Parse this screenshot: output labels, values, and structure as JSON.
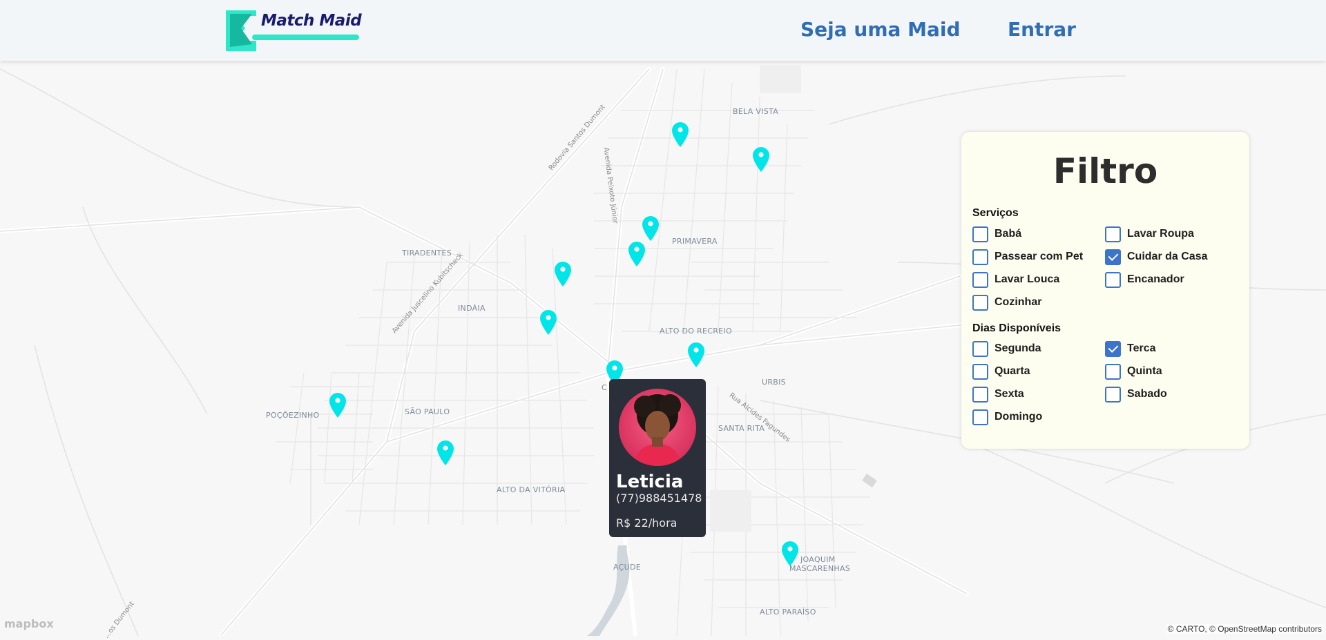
{
  "header": {
    "logo_text": "Match Maid",
    "nav": {
      "maid_link": "Seja uma Maid",
      "login_link": "Entrar"
    }
  },
  "map": {
    "neighborhoods": [
      {
        "key": "bela-vista",
        "label": "BELA VISTA"
      },
      {
        "key": "tiradentes",
        "label": "TIRADENTES"
      },
      {
        "key": "primavera",
        "label": "PRIMAVERA"
      },
      {
        "key": "indaia",
        "label": "INDÁIA"
      },
      {
        "key": "alto-do-recreio",
        "label": "ALTO DO RECREIO"
      },
      {
        "key": "urbis",
        "label": "URBIS"
      },
      {
        "key": "pocoezinho",
        "label": "POÇÕEZINHO"
      },
      {
        "key": "sao-paulo",
        "label": "SÃO PAULO"
      },
      {
        "key": "santa-rita",
        "label": "SANTA RITA"
      },
      {
        "key": "alto-da-vitoria",
        "label": "ALTO DA VITÓRIA"
      },
      {
        "key": "acude",
        "label": "AÇUDE"
      },
      {
        "key": "joaquim-mascarenhas-1",
        "label": "JOAQUIM"
      },
      {
        "key": "joaquim-mascarenhas-2",
        "label": "MASCARENHAS"
      },
      {
        "key": "alto-paraiso",
        "label": "ALTO PARAÍSO"
      },
      {
        "key": "centro-partial",
        "label": "C"
      }
    ],
    "roads": [
      {
        "key": "rodovia-santos-dumont",
        "label": "Rodovia Santos Dumont"
      },
      {
        "key": "avenida-peixoto",
        "label": "Avenida Peixoto Júnior"
      },
      {
        "key": "avenida-juscelino",
        "label": "Avenida Juscelino Kubitscheck"
      },
      {
        "key": "rua-alcides",
        "label": "Rua Alcides Fagundes"
      },
      {
        "key": "santos-dumont-bottom",
        "label": "...os Dumont"
      }
    ],
    "marker_color": "#00e5e8",
    "marker_icon": "map-pin-icon",
    "attribution": "© CARTO, © OpenStreetMap contributors",
    "provider_logo": "mapbox"
  },
  "popup": {
    "name": "Leticia",
    "phone": "(77)988451478",
    "price": "R$ 22/hora",
    "avatar_icon": "profile-photo"
  },
  "filter": {
    "title": "Filtro",
    "services_title": "Serviços",
    "services": [
      {
        "label": "Babá",
        "checked": false
      },
      {
        "label": "Lavar Roupa",
        "checked": false
      },
      {
        "label": "Passear com Pet",
        "checked": false
      },
      {
        "label": "Cuidar da Casa",
        "checked": true
      },
      {
        "label": "Lavar Louca",
        "checked": false
      },
      {
        "label": "Encanador",
        "checked": false
      },
      {
        "label": "Cozinhar",
        "checked": false
      }
    ],
    "days_title": "Dias Disponíveis",
    "days": [
      {
        "label": "Segunda",
        "checked": false
      },
      {
        "label": "Terca",
        "checked": true
      },
      {
        "label": "Quarta",
        "checked": false
      },
      {
        "label": "Quinta",
        "checked": false
      },
      {
        "label": "Sexta",
        "checked": false
      },
      {
        "label": "Sabado",
        "checked": false
      },
      {
        "label": "Domingo",
        "checked": false
      }
    ],
    "accent_color": "#3d74c9"
  }
}
